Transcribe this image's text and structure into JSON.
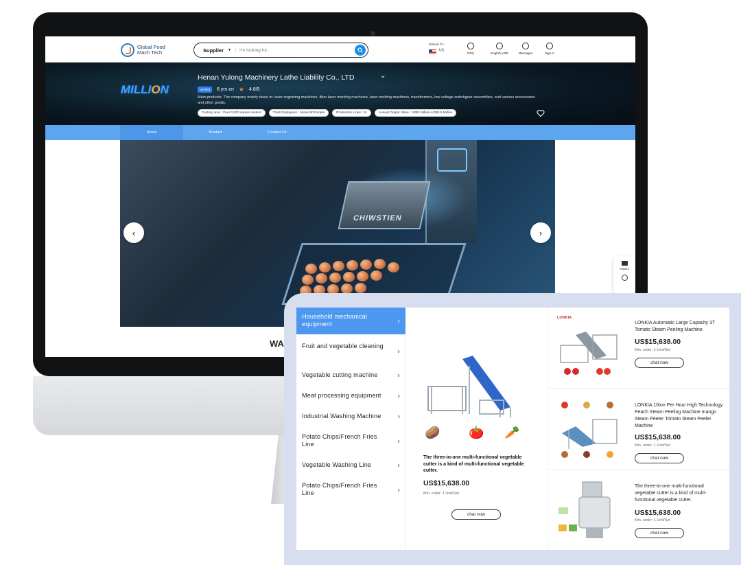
{
  "nav": {
    "logo_line1": "Global Food",
    "logo_line2": "Mach Tech",
    "search_category": "Supplier",
    "search_placeholder": "I'm looking for...",
    "deliver_label": "Deliver To :",
    "deliver_country": "US",
    "icons": [
      {
        "label": "RFQ",
        "icon": "rfq-icon"
      },
      {
        "label": "English-USD",
        "icon": "globe-icon"
      },
      {
        "label": "Messages",
        "icon": "message-icon"
      },
      {
        "label": "Sign In",
        "icon": "user-icon"
      }
    ]
  },
  "company": {
    "logo_text_a": "M",
    "logo_text_b": "ILLI",
    "logo_text_c": "O",
    "logo_text_d": "N",
    "name": "Henan Yulong Machinery Lathe Liability Co., LTD",
    "verified": "Verified",
    "years": "6 yrs·cn",
    "rating": "4.8/5",
    "description": "Main products: The company mainly deals in: laser engraving machines, fiber laser marking machines, laser welding machines, transformers, low-voltage switchgear assemblies, and various accessories and other goods.",
    "pills": [
      "Factory area : Over 2,000 square meters",
      "Total Employees : Above 50 People",
      "Production Lines : 11",
      "Annual Output Value : US$1 Million-US$2.5 Million"
    ]
  },
  "tabs": [
    "Home",
    "Product",
    "Contact Us"
  ],
  "hero": {
    "machine_text": "CHIWSTIEN",
    "heading_fragment": "WA"
  },
  "side_tools": {
    "inquiry": "Inquiry"
  },
  "categories": [
    "Household mechanical equipment",
    "Fruit and vegetable cleaning",
    "Vegetable cutting machine",
    "Meat processing equipment",
    "Industrial Washing Machine",
    "Potato Chips/French Fries Line",
    "Vegetable Washing Line",
    "Potato Chips/French Fries Line"
  ],
  "featured": {
    "description": "The three-in-one multi-functional vegetable cutter is a kind of multi-functional vegetable cutter.",
    "price": "US$15,638.00",
    "min_order": "Min. order:  1 Unit/Set",
    "chat": "chat now"
  },
  "products": [
    {
      "brand": "LONKIA",
      "title": "LONKIA Automatic Large Capacity 3T Tomato Steam Peeling Machine",
      "price": "US$15,638.00",
      "min_order": "Min. order:  1 Unit/Set",
      "chat": "chat now"
    },
    {
      "title": "LONKIA 10ton Per Hour High Technology Peach Steam Peeling Machine mango Steam Peeler Tomato Steam Peeler Machine",
      "price": "US$15,638.00",
      "min_order": "Min. order:  1 Unit/Set",
      "chat": "chat now"
    },
    {
      "title": "The three-in-one multi-functional vegetable cutter is a kind of multi-functional vegetable cutter.",
      "price": "US$15,638.00",
      "min_order": "Min. order:  1 Unit/Set",
      "chat": "chat now"
    }
  ],
  "colors": {
    "accent_blue": "#5ea5ef",
    "active_blue": "#4c97f0",
    "search_blue": "#1a8fe8",
    "star_orange": "#f08a3c"
  }
}
